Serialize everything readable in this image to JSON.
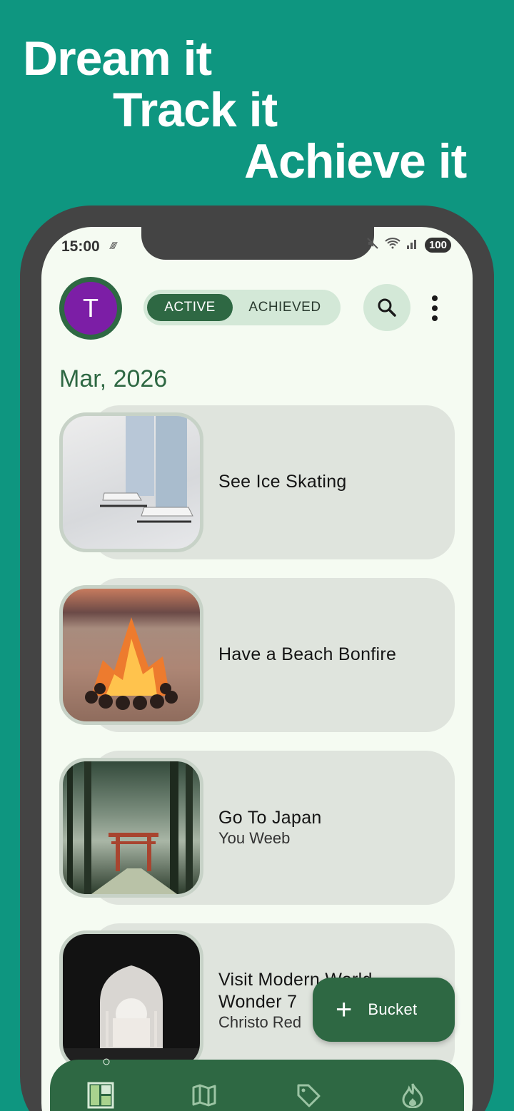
{
  "promo": {
    "line1": "Dream it",
    "line2": "Track it",
    "line3": "Achieve it"
  },
  "status_bar": {
    "time": "15:00",
    "battery": "100"
  },
  "header": {
    "avatar_initial": "T",
    "toggle": {
      "active_label": "ACTIVE",
      "achieved_label": "ACHIEVED",
      "selected": "ACTIVE"
    }
  },
  "section": {
    "date": "Mar, 2026"
  },
  "items": [
    {
      "title": "See Ice Skating",
      "subtitle": ""
    },
    {
      "title": "Have a Beach Bonfire",
      "subtitle": ""
    },
    {
      "title": "Go To Japan",
      "subtitle": "You Weeb"
    },
    {
      "title": "Visit Modern World Wonder 7",
      "subtitle": "Christo Red"
    }
  ],
  "fab": {
    "label": "Bucket"
  },
  "bottom_nav": {
    "items": [
      "dashboard-icon",
      "map-icon",
      "tag-icon",
      "flame-icon"
    ],
    "selected": "dashboard-icon"
  },
  "colors": {
    "background": "#0e9680",
    "primary": "#2e6843",
    "avatar": "#7c1ea6",
    "card": "#dfe4dd",
    "surface": "#f5fbf2"
  }
}
